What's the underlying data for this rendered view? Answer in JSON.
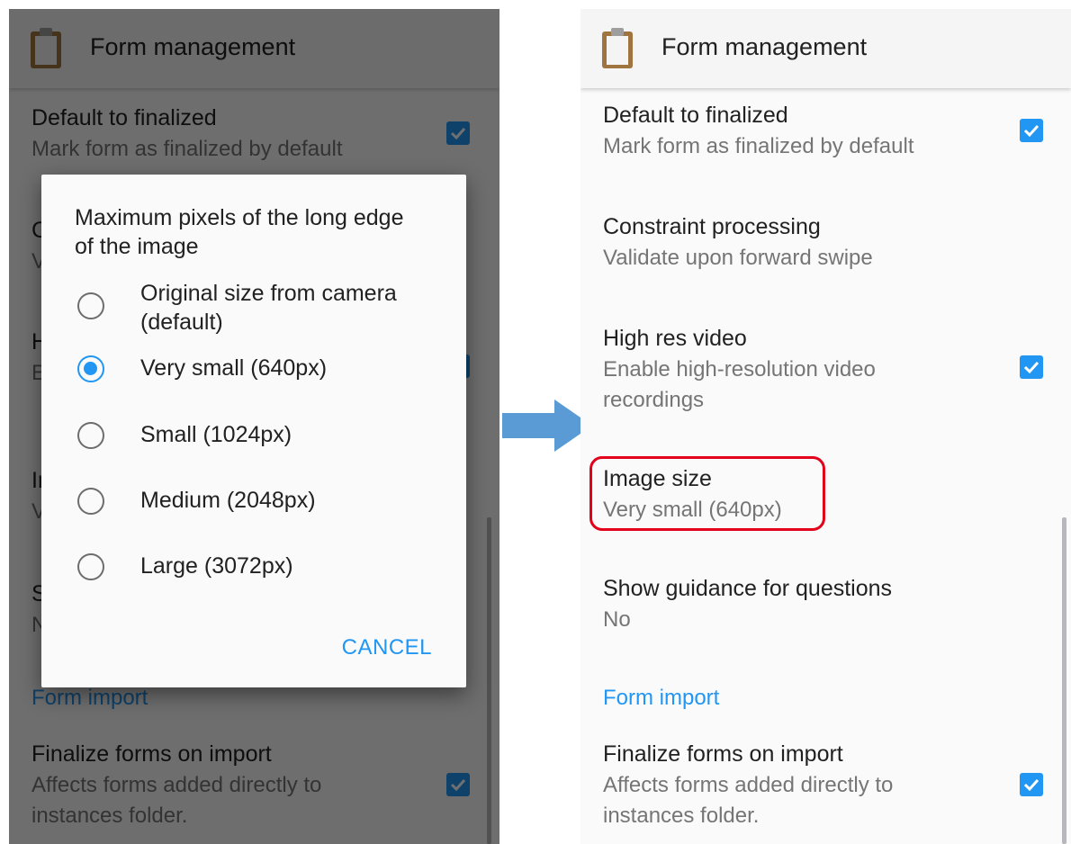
{
  "app_bar": {
    "title": "Form management",
    "icon": "clipboard-icon"
  },
  "preferences": {
    "default_to_finalized": {
      "title": "Default to finalized",
      "summary": "Mark form as finalized by default",
      "checked": true
    },
    "constraint_processing": {
      "title": "Constraint processing",
      "summary": "Validate upon forward swipe"
    },
    "high_res_video": {
      "title": "High res video",
      "summary": "Enable high-resolution video recordings",
      "checked": true
    },
    "image_size": {
      "title": "Image size",
      "summary": "Very small (640px)"
    },
    "show_guidance": {
      "title": "Show guidance for questions",
      "summary": "No"
    },
    "form_import_category": "Form import",
    "finalize_on_import": {
      "title": "Finalize forms on import",
      "summary": "Affects forms added directly to instances folder.",
      "checked": true
    }
  },
  "dialog": {
    "title": "Maximum pixels of the long edge of the image",
    "options": [
      {
        "label": "Original size from camera (default)",
        "selected": false
      },
      {
        "label": "Very small (640px)",
        "selected": true
      },
      {
        "label": "Small (1024px)",
        "selected": false
      },
      {
        "label": "Medium (2048px)",
        "selected": false
      },
      {
        "label": "Large (3072px)",
        "selected": false
      }
    ],
    "cancel_label": "CANCEL"
  },
  "colors": {
    "accent": "#2196f3",
    "highlight": "#e3001b",
    "arrow": "#5b9bd5"
  }
}
